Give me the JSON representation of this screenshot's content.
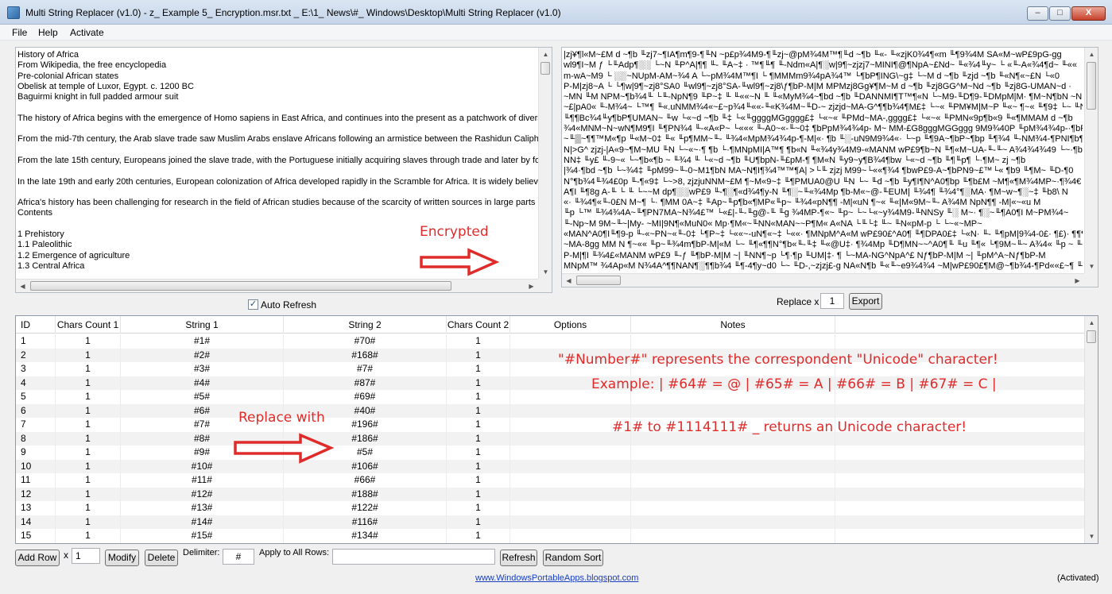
{
  "window": {
    "title": "Multi String Replacer (v1.0) - z_ Example 5_ Encryption.msr.txt _ E:\\1_ News\\#_ Windows\\Desktop\\Multi String Replacer (v1.0)",
    "minimize": "–",
    "maximize": "□",
    "close": "X"
  },
  "menu": {
    "file": "File",
    "help": "Help",
    "activate": "Activate"
  },
  "plain_text": {
    "lines": [
      "History of Africa",
      "From Wikipedia, the free encyclopedia",
      "Pre-colonial African states",
      "Obelisk at temple of Luxor, Egypt. c. 1200 BC",
      "Baguirmi knight in full padded armour suit",
      "",
      "The history of Africa begins with the emergence of Homo sapiens in East Africa, and continues into the present as a patchwork of divers",
      "",
      "From the mid-7th century, the Arab slave trade saw Muslim Arabs enslave Africans following an armistice between the Rashidun Caliphat",
      "",
      "From the late 15th century, Europeans joined the slave trade, with the Portuguese initially acquiring slaves through trade and later by forc",
      "",
      "In the late 19th and early 20th centuries, European colonization of Africa developed rapidly in the Scramble for Africa. It is widely believe",
      "",
      "Africa's history has been challenging for research in the field of African studies because of the scarcity of written sources in large parts of",
      "Contents",
      "",
      "   1 Prehistory",
      "      1.1 Paleolithic",
      "      1.2 Emergence of agriculture",
      "      1.3 Central Africa"
    ]
  },
  "encrypted_text": {
    "lines": [
      "|zj¥¶l«M~£M  d    ~¶b ╙zj7~¶IA¶m¶9-¶╙N    ~p£p¾4M9-¶╙zj~@pM¾4M™¶╙d    ~¶b ╙«- ╙«zjK0¾4¶«m ╙¶9¾4M     SA«M~wP£9pG-gg",
      "wl9¶I~M   ƒ └╙Adp¶░░          └~N ╙P^A|¶¶ ╙- ╙A~‡ · ™¶╙¶ ╙-Ndm«A|¶░w|9¶~zjzj7~MINI¶@¶NpA~£Nd~ ╙«¾4╙y~ └ «╙-A«¾4¶d~ ╙««",
      "m-wA~M9 └   ░░~NUpM-AM~¾4 A └~pM¾4M™¶I └  ¶MMMm9¾4pA¾4™ └¶bP¶ING\\~g‡ └~M  d    ~¶b ╙zjd    ~¶b ╙«N¶«~£N └«0",
      "P-M|zj8~A └ └¶w|9¶~zj8°SA0 ╙wl9¶~zj8°SA-╙wl9¶~zj8\\ƒ¶bP-M|M    MPMzj8Gg¥¶M~M    d    ~¶b ╙zj8GG^M~Nd    ~¶b ╙zj8G-UMAN~d  ·",
      "~MN ╙M     NPM~¶b¾4╙ └╙-NpN¶9 ╙P~‡ ╙ ╙««~N ╙ ╙«MyM¾4~¶bd    ~¶b ╙DANNMI¶T™¶«N └~M9-╙D¶9-╙DMpM|M· ¶M~N¶bN    ~N",
      "~£|pA0« ╙-M¾4~ └™¶ ╙«.uNMM¾4«~£~p¾4╙««-╙«K¾4M~╙D-~ zjzjd~MA-G^¶¶b¾4¶M£‡ └~« ╙PM¥M|M~P ╙«~     ¶~« ╙¶9‡ └~ ╙N    M««",
      "╙¶¶Bc¾4╙y¶bP¶UMAN~ ╙w └«~d    ~¶b ╙‡ └«╙ggggMGgggg£‡ └«~« ╙PMd~MA-,gggg£‡ └«~« ╙PMN«9p¶b«9 ╙«¶MMAM   d    ~¶b",
      "¾4«MNM~N~wN¶M9¶I ╙¶PN¾4 ╙-«A«P~ └««« ╙-A0~«-╙~0‡ ¶bPpM¾4¾4p-    M~      MM-£G8gggMGGggg          9M9¾40P ╙pM¾4¾4p-·¶bP",
      "~╙▒~¶¶™M«¶p ╙«M~0‡ ╙« ╙p¶MM~╙- ╙¾4«MpM¾4¾4p-¶-M|«· ¶b ╙░-uN9M9¾4«· └~p ╙¶9A~¶bP~¶bp ╙¶¾4 ╙-NM¾4-¶PNI¶b¶¶~pA¾4 └~NM~N-P",
      "N|>G^ zjzj-|A«9~¶M~MU ╙N └~«~·¶   ¶b └·¶MNpMI|A™¶ ¶b«N ╙«¾4y¾4M9-«MANM    wP£9¶b~N ╙¶«M~UA-╙-╙~     A¾4¾4¾49 └~·¶b ╙««",
      "NN‡ ╙y£ ╙-9~« └~¶b«¶b     ~ ╙¾4 ╙ └«~d    ~¶b ╙U¶bpN-╙£pM-¶ ¶M«N ╙y9~y¶B¾4¶bw └«~d     ~¶b ╙¶╙p¶ └·¶M~ zj    ~¶b",
      "|¾4·¶bd    ~¶b └~¾4‡ ╙pM99~╙-0~M1¶bN    MA~N¶I¶¾4™™¶A|        >└╙ zjzj     M99~└««¶¾4 ¶bwP£9-A~¶bPN9~£™└«  ¶b9 ╙¶M~ ╙D-¶0",
      "N°¶b¾4╙¾4£0p ╙-¶«9‡ └~>8, zjzjuNNM~£M   ¶~M«9~‡ ╙¶PMUA0@U ╙N └~ ╙d    ~¶b ╙y¶I¶N^A0¶bp ╙¶b£M    ~M¶«¶M¾4MP~·¶¾4€ ╙p",
      "    A¶I ╙¶8g            A-╙ └ ╙ └~~M    dp¶░░wP£9 ╙-¶░¶«d¾4¶y-N ╙¶░~╙«¾4Mp ¶b-M«~@-╙EUM| ╙¾4¶ ╙¾4°¶░MA· ¶M~w~¶░~‡ ╙b8\\ N",
      "«· ╙¾4¶«╙-0£N     M~¶ └· ¶MM     0A~‡ ╙Ap~╙p¶b«¶MP«╙p~ ╙¾4«pN¶¶    -M|«uN    ¶~« ╙«|M«9M~╙-      A¾4M    NpN¶¶    -M|«~«u  M",
      "╙p └™ ╙¾4¾4A~╙¶PN7MA~N¾4£™ └«£|-╙-╙g@-╙ ╙g          ¾4MP-¶«~ ╙p~ └~└«~y¾4M9-╙NNSy ╙░    M~· ¶░~╙¶A0¶I    M~PM¾4~",
      "╙-Np~M     9M~╙~|My-      ~MI|9N¶«MuN0«           Mp·¶M«~╙NN«MAN~~P¶M«    A«NA └╙└‡ ╙~ ╙N«pM-p └ └~«~MP~",
      "«MAN^A0¶I╙¶9-p ╙-«~PN~«╙-0‡ └¶P~‡ └««~-uN¶«~‡ └««· ¶MNpM^A«M    wP£90£^A0¶ ╙¶DPA0£‡ └«N· ╙- ╙¶pM|9¾4-0£· ¶£)· ¶¶¶Nm",
      "~MA-8gg MM    N   ¶~«« ╙p~╙¾4m¶bP-M|«M └~ ╙¶«¶¶N°¶b«╙-╙‡ ╙«@U‡· ¶¾4Mp ╙D¶MN~~^A0¶╙ ╙u ╙¶« └¶9M~╙~    A¾4« ╙p ~ ╙««",
      "P-M|¶I ╙¾4£«MANM    wP£9 ╙-ƒ ╙¶bP-M|M     ~| ╙NN¶~p └¶·¶p ╙UM|‡· ¶ └~MA-NG^NpA^£          Nƒ¶bP-M|M    ~| ╙pM^A~Nƒ¶bP-M",
      "MNpM™      ¾4Ap«M    N¾4A^¶¶NAN¶░¶¶b¾4 ╙¶-4¶y~d0 └~ ╙D-,~zjzj£-g      NA«N¶b ╙«╙~e9¾4¾4     ~M|wP£90£¶M@~¶b¾4-¶Pd««£~¶ ╙«5 ╙"
    ]
  },
  "annotations": {
    "encrypted": "Encrypted",
    "replace_with": "Replace with",
    "note_line1": "\"#Number#\" represents the correspondent \"Unicode\" character!",
    "note_line2": "Example: | #64# = @ | #65# = A | #66# = B | #67# = C |",
    "note_line3": "#1# to #1114111# _ returns an Unicode character!",
    "color": "#e02b2b"
  },
  "controls": {
    "auto_refresh_label": "Auto Refresh",
    "auto_refresh_checked": true,
    "replace_x_label": "Replace x",
    "replace_x_value": "1",
    "export_label": "Export"
  },
  "grid": {
    "columns": [
      "ID",
      "Chars Count 1",
      "String 1",
      "String 2",
      "Chars Count 2",
      "Options",
      "Notes"
    ],
    "rows": [
      [
        "1",
        "1",
        "#1#",
        "#70#",
        "1"
      ],
      [
        "2",
        "1",
        "#2#",
        "#168#",
        "1"
      ],
      [
        "3",
        "1",
        "#3#",
        "#7#",
        "1"
      ],
      [
        "4",
        "1",
        "#4#",
        "#87#",
        "1"
      ],
      [
        "5",
        "1",
        "#5#",
        "#69#",
        "1"
      ],
      [
        "6",
        "1",
        "#6#",
        "#40#",
        "1"
      ],
      [
        "7",
        "1",
        "#7#",
        "#196#",
        "1"
      ],
      [
        "8",
        "1",
        "#8#",
        "#186#",
        "1"
      ],
      [
        "9",
        "1",
        "#9#",
        "#5#",
        "1"
      ],
      [
        "10",
        "1",
        "#10#",
        "#106#",
        "1"
      ],
      [
        "11",
        "1",
        "#11#",
        "#66#",
        "1"
      ],
      [
        "12",
        "1",
        "#12#",
        "#188#",
        "1"
      ],
      [
        "13",
        "1",
        "#13#",
        "#122#",
        "1"
      ],
      [
        "14",
        "1",
        "#14#",
        "#116#",
        "1"
      ],
      [
        "15",
        "1",
        "#15#",
        "#134#",
        "1"
      ]
    ]
  },
  "bottom": {
    "add_row": "Add Row",
    "x_label": "x",
    "count_value": "1",
    "modify": "Modify",
    "delete": "Delete",
    "delimiter_label": "Delimiter:",
    "delimiter_value": "#",
    "apply_label": "Apply to All Rows:",
    "apply_value": "",
    "refresh": "Refresh",
    "random_sort": "Random Sort"
  },
  "footer": {
    "link": "www.WindowsPortableApps.blogspot.com",
    "status": "(Activated)"
  }
}
